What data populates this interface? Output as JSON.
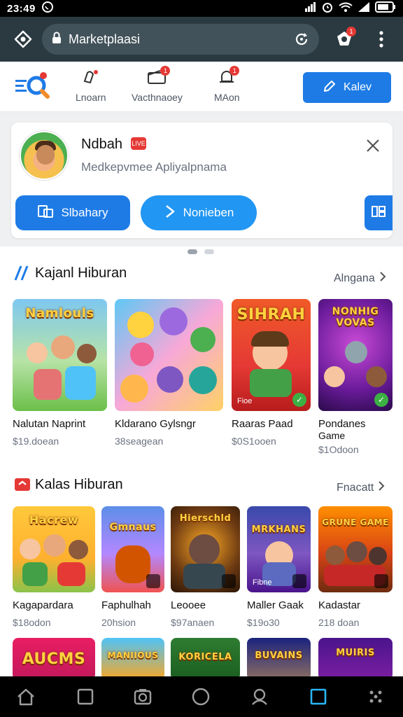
{
  "status_bar": {
    "time": "23:49",
    "icons": [
      "whatsapp-icon",
      "signal-icon",
      "alarm-icon",
      "wifi-icon",
      "signal-icon",
      "battery-icon"
    ]
  },
  "browser": {
    "url": "Marketplaasi",
    "notification_count": "1"
  },
  "top_nav": {
    "items": [
      {
        "label": "Lnoarn",
        "icon": "edit-pen-icon"
      },
      {
        "label": "Vacthnaoey",
        "icon": "wallet-icon",
        "badge": "1"
      },
      {
        "label": "MAon",
        "icon": "bell-icon",
        "badge": "1"
      }
    ],
    "action_label": "Kalev"
  },
  "profile": {
    "name": "Ndbah",
    "badge": "LIVE",
    "subtitle": "Medkepvmee Apliyalpnama",
    "pills": [
      {
        "label": "Slbahary",
        "icon": "library-icon"
      },
      {
        "label": "Nonieben",
        "icon": "arrow-right-icon"
      },
      {
        "label": "",
        "icon": "grid-icon"
      }
    ]
  },
  "sections": [
    {
      "title": "Kajanl Hiburan",
      "more": "Alngana",
      "items": [
        {
          "thumb_title": "Namlouls",
          "name": "Nalutan  Naprint",
          "name2": "",
          "price": "$19.doean"
        },
        {
          "thumb_title": "",
          "name": "Kldarano  Gylsngr",
          "name2": "",
          "price": "38seagean"
        },
        {
          "thumb_title": "SIHRAH",
          "thumb_label": "Fioe",
          "name": "Raaras Paad",
          "name2": "",
          "price": "$0S1ooen"
        },
        {
          "thumb_title": "NONHIG VOVAS",
          "name": "Pondanes",
          "name2": "Game",
          "price": "$1Odoon"
        }
      ]
    },
    {
      "title": "Kalas Hiburan",
      "more": "Fnacatt",
      "items": [
        {
          "thumb_title": "Hacrew",
          "name": "Kagapardara",
          "price": "$18odon"
        },
        {
          "thumb_title": "Gmnaus",
          "name": "Faphulhah",
          "price": "20hsion"
        },
        {
          "thumb_title": "Hierschld",
          "name": "Leooee",
          "price": "$97anaen"
        },
        {
          "thumb_title": "MRKHANS",
          "thumb_label": "Fibne",
          "name": "Maller Gaak",
          "price": "$19o30"
        },
        {
          "thumb_title": "GRUNE GAME",
          "name": "Kadastar",
          "price": "218 doan"
        }
      ]
    },
    {
      "items": [
        {
          "thumb_title": "AUCMS"
        },
        {
          "thumb_title": "MANIIOUS"
        },
        {
          "thumb_title": "KORICELA"
        },
        {
          "thumb_title": "BUVAINS"
        },
        {
          "thumb_title": "MUIRIS"
        }
      ]
    }
  ],
  "bottom_bar": {
    "items": [
      "home-icon",
      "square-icon",
      "camera-icon",
      "circle-icon",
      "search-icon",
      "square-active-icon",
      "dots-icon"
    ]
  },
  "colors": {
    "accent": "#1e7be6",
    "toolbar": "#2b3a41",
    "badge": "#e53935"
  }
}
